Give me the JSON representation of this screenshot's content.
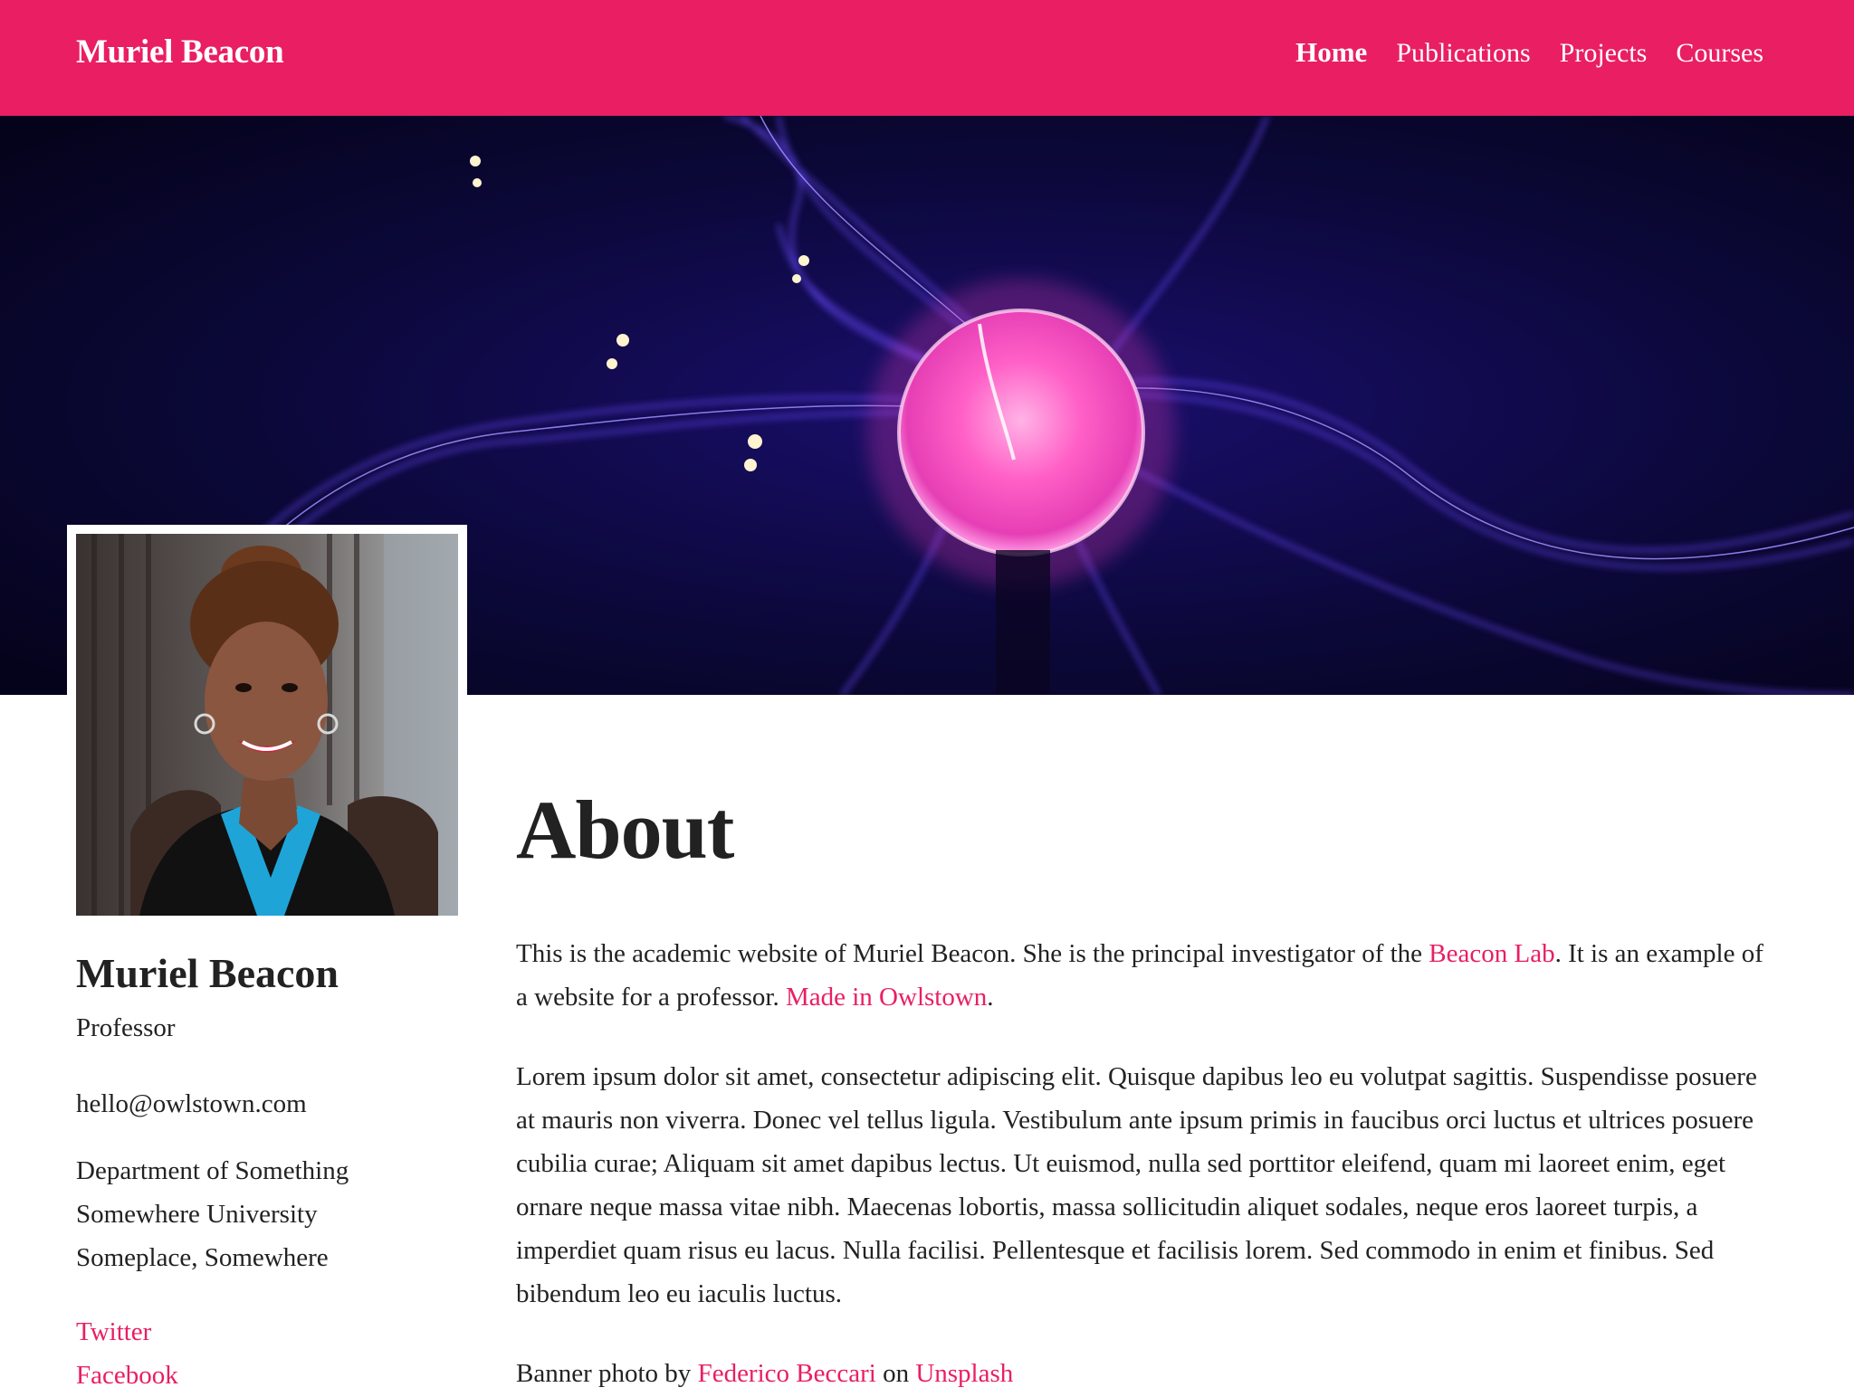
{
  "header": {
    "brand": "Muriel Beacon",
    "nav": [
      {
        "label": "Home",
        "active": true
      },
      {
        "label": "Publications"
      },
      {
        "label": "Projects"
      },
      {
        "label": "Courses"
      }
    ]
  },
  "profile": {
    "name": "Muriel Beacon",
    "role": "Professor",
    "email": "hello@owlstown.com",
    "address": [
      "Department of Something",
      "Somewhere University",
      "Someplace, Somewhere"
    ],
    "social": [
      "Twitter",
      "Facebook"
    ]
  },
  "about": {
    "title": "About",
    "p1_a": "This is the academic website of Muriel Beacon. She is the principal investigator of the ",
    "p1_link1": "Beacon Lab",
    "p1_b": ". It is an example of a website for a professor. ",
    "p1_link2": "Made in Owlstown",
    "p1_c": ".",
    "p2": "Lorem ipsum dolor sit amet, consectetur adipiscing elit. Quisque dapibus leo eu volutpat sagittis. Suspendisse posuere at mauris non viverra. Donec vel tellus ligula. Vestibulum ante ipsum primis in faucibus orci luctus et ultrices posuere cubilia curae; Aliquam sit amet dapibus lectus. Ut euismod, nulla sed porttitor eleifend, quam mi laoreet enim, eget ornare neque massa vitae nibh. Maecenas lobortis, massa sollicitudin aliquet sodales, neque eros laoreet turpis, a imperdiet quam risus eu lacus. Nulla facilisi. Pellentesque et facilisis lorem. Sed commodo in enim et finibus. Sed bibendum leo eu iaculis luctus.",
    "credit_a": "Banner photo by ",
    "credit_link1": "Federico Beccari",
    "credit_b": " on ",
    "credit_link2": "Unsplash"
  },
  "colors": {
    "accent": "#e91e63",
    "text": "#222222",
    "banner_bg": "#07052a"
  }
}
